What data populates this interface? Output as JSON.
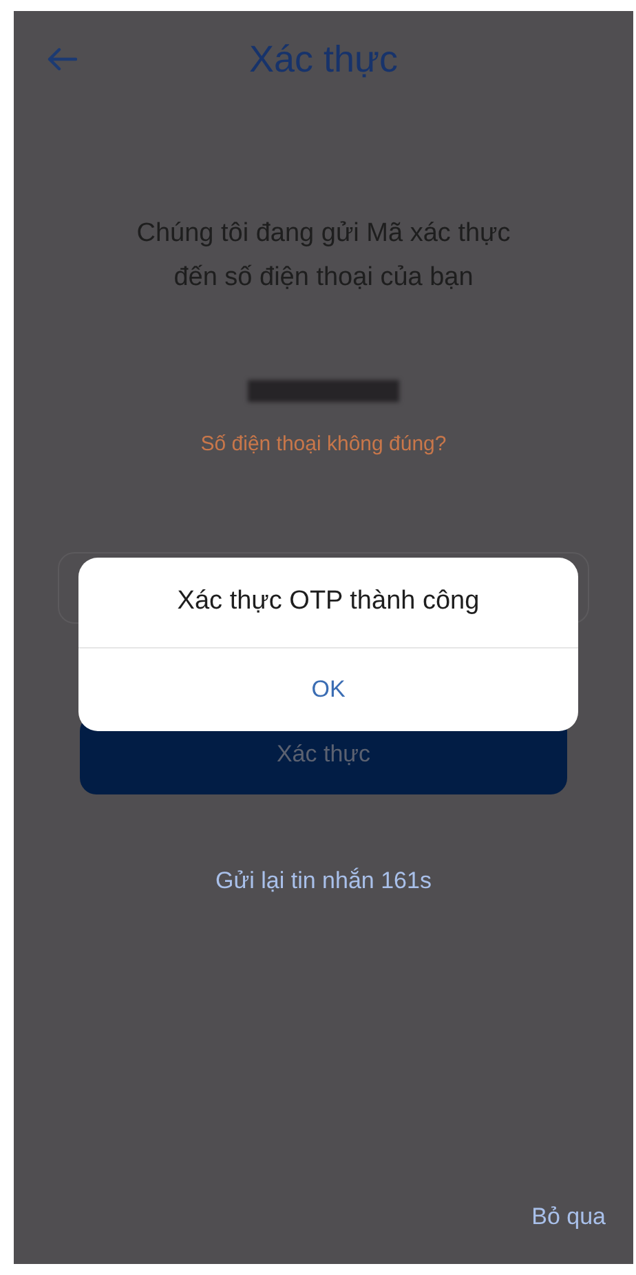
{
  "header": {
    "title": "Xác thực"
  },
  "message": "Chúng tôi đang gửi Mã xác thực đến số điện thoại của bạn",
  "wrong_number_link": "Số điện thoại không đúng?",
  "submit_button": "Xác thực",
  "resend_link": "Gửi lại tin nhắn 161s",
  "skip_link": "Bỏ qua",
  "dialog": {
    "message": "Xác thực OTP thành công",
    "button": "OK"
  }
}
